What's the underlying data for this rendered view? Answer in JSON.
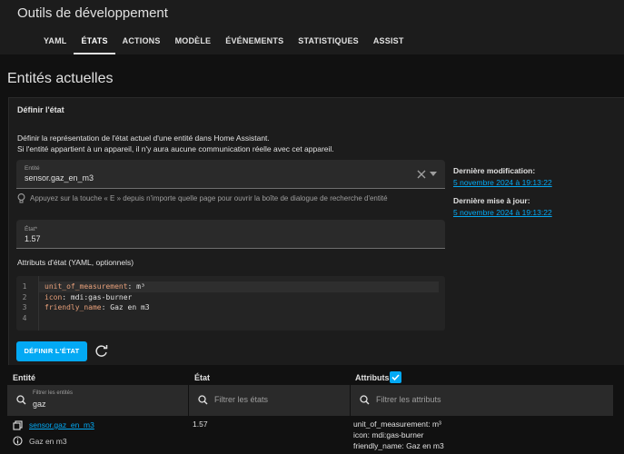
{
  "header": {
    "title": "Outils de développement",
    "tabs": [
      "YAML",
      "ÉTATS",
      "ACTIONS",
      "MODÈLE",
      "ÉVÉNEMENTS",
      "STATISTIQUES",
      "ASSIST"
    ],
    "active_tab": "ÉTATS"
  },
  "page_title": "Entités actuelles",
  "card": {
    "title": "Définir l'état",
    "desc_line1": "Définir la représentation de l'état actuel d'une entité dans Home Assistant.",
    "desc_line2": "Si l'entité appartient à un appareil, il n'y aura aucune communication réelle avec cet appareil.",
    "entity_label": "Entité",
    "entity_value": "sensor.gaz_en_m3",
    "hint": "Appuyez sur la touche « E » depuis n'importe quelle page pour ouvrir la boîte de dialogue de recherche d'entité",
    "state_label": "État*",
    "state_value": "1.57",
    "attributes_label": "Attributs d'état (YAML, optionnels)",
    "yaml_lines": [
      {
        "key": "unit_of_measurement",
        "value": " m³"
      },
      {
        "key": "icon",
        "value": " mdi:gas-burner"
      },
      {
        "key": "friendly_name",
        "value": " Gaz en m3"
      },
      {
        "key": "",
        "value": ""
      }
    ],
    "line_numbers": [
      "1",
      "2",
      "3",
      "4"
    ],
    "set_state_button": "DÉFINIR L'ÉTAT",
    "last_changed_label": "Dernière modification:",
    "last_changed_value": "5 novembre 2024 à 19:13:22",
    "last_updated_label": "Dernière mise à jour:",
    "last_updated_value": "5 novembre 2024 à 19:13:22"
  },
  "table": {
    "col_entity": "Entité",
    "col_state": "État",
    "col_attributes": "Attributs",
    "filter_entities_label": "Filtrer les entités",
    "filter_entities_value": "gaz",
    "filter_states_placeholder": "Filtrer les états",
    "filter_attributes_placeholder": "Filtrer les attributs",
    "rows": [
      {
        "entity_id": "sensor.gaz_en_m3",
        "friendly": "Gaz en m3",
        "state": "1.57",
        "attr1": "unit_of_measurement: m³",
        "attr2": "icon: mdi:gas-burner",
        "attr3": "friendly_name: Gaz en m3"
      }
    ]
  },
  "colors": {
    "accent": "#03a9f4",
    "background": "#111111",
    "card": "#1c1c1c"
  }
}
